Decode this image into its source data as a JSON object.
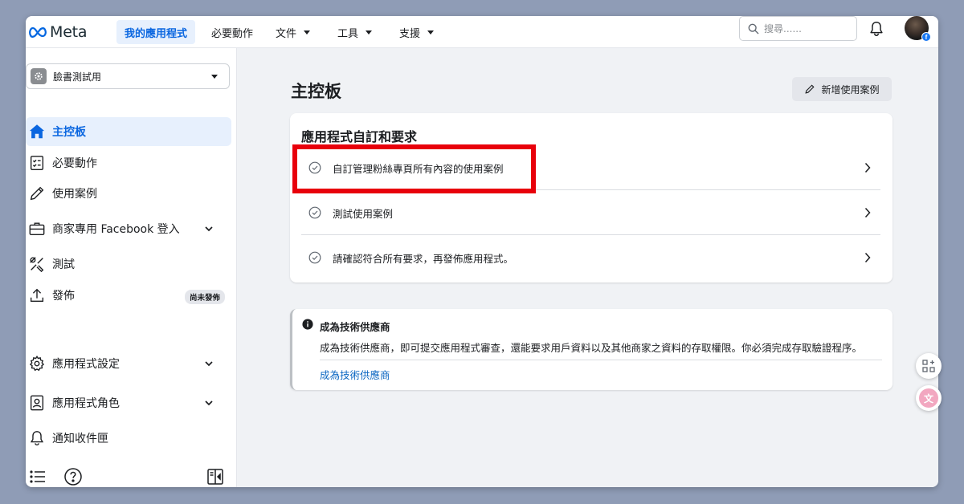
{
  "topbar": {
    "brand": "Meta",
    "nav": [
      {
        "label": "我的應用程式"
      },
      {
        "label": "必要動作"
      },
      {
        "label": "文件"
      },
      {
        "label": "工具"
      },
      {
        "label": "支援"
      }
    ],
    "search_placeholder": "搜尋......"
  },
  "sidebar": {
    "app_name": "臉書測試用",
    "items": [
      {
        "label": "主控板"
      },
      {
        "label": "必要動作"
      },
      {
        "label": "使用案例"
      },
      {
        "label": "商家專用 Facebook 登入"
      },
      {
        "label": "測試"
      },
      {
        "label": "發佈",
        "badge": "尚未發佈"
      },
      {
        "label": "應用程式設定"
      },
      {
        "label": "應用程式角色"
      },
      {
        "label": "通知收件匣"
      }
    ]
  },
  "main": {
    "title": "主控板",
    "add_button": "新增使用案例",
    "card1": {
      "title": "應用程式自訂和要求",
      "rows": [
        {
          "label": "自訂管理粉絲專頁所有內容的使用案例"
        },
        {
          "label": "測試使用案例"
        },
        {
          "label": "請確認符合所有要求，再發佈應用程式。"
        }
      ]
    },
    "card2": {
      "title": "成為技術供應商",
      "description": "成為技術供應商，即可提交應用程式審查，還能要求用戶資料以及其他商家之資料的存取權限。你必須完成存取驗證程序。",
      "link": "成為技術供應商"
    }
  },
  "widgets": {
    "translate_label": "文"
  },
  "colors": {
    "accent": "#0a66e0",
    "highlight": "#e8000b",
    "background": "#8f9cb6"
  }
}
